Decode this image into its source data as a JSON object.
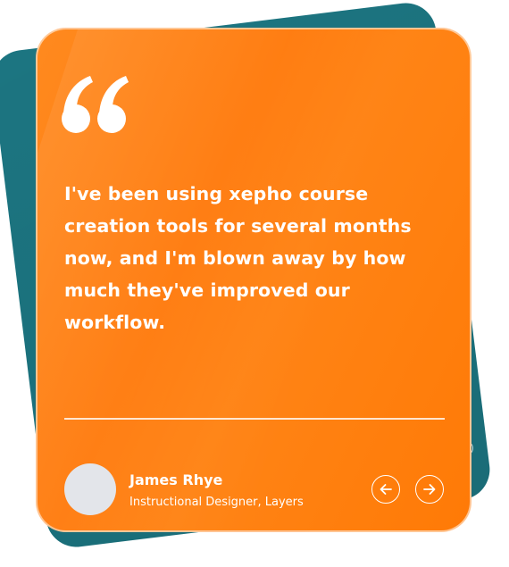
{
  "testimonial": {
    "quote": "I've been using xepho course creation tools for several months now, and I'm blown away by how much they've improved our workflow.",
    "author_name": "James Rhye",
    "author_role": "Instructional Designer, Layers"
  },
  "icons": {
    "quote": "quote-mark-icon",
    "prev": "arrow-left-icon",
    "next": "arrow-right-icon"
  },
  "colors": {
    "card": "#ff7f0e",
    "back_card": "#1c7581",
    "text": "#ffffff",
    "avatar": "#e3e5ea"
  }
}
